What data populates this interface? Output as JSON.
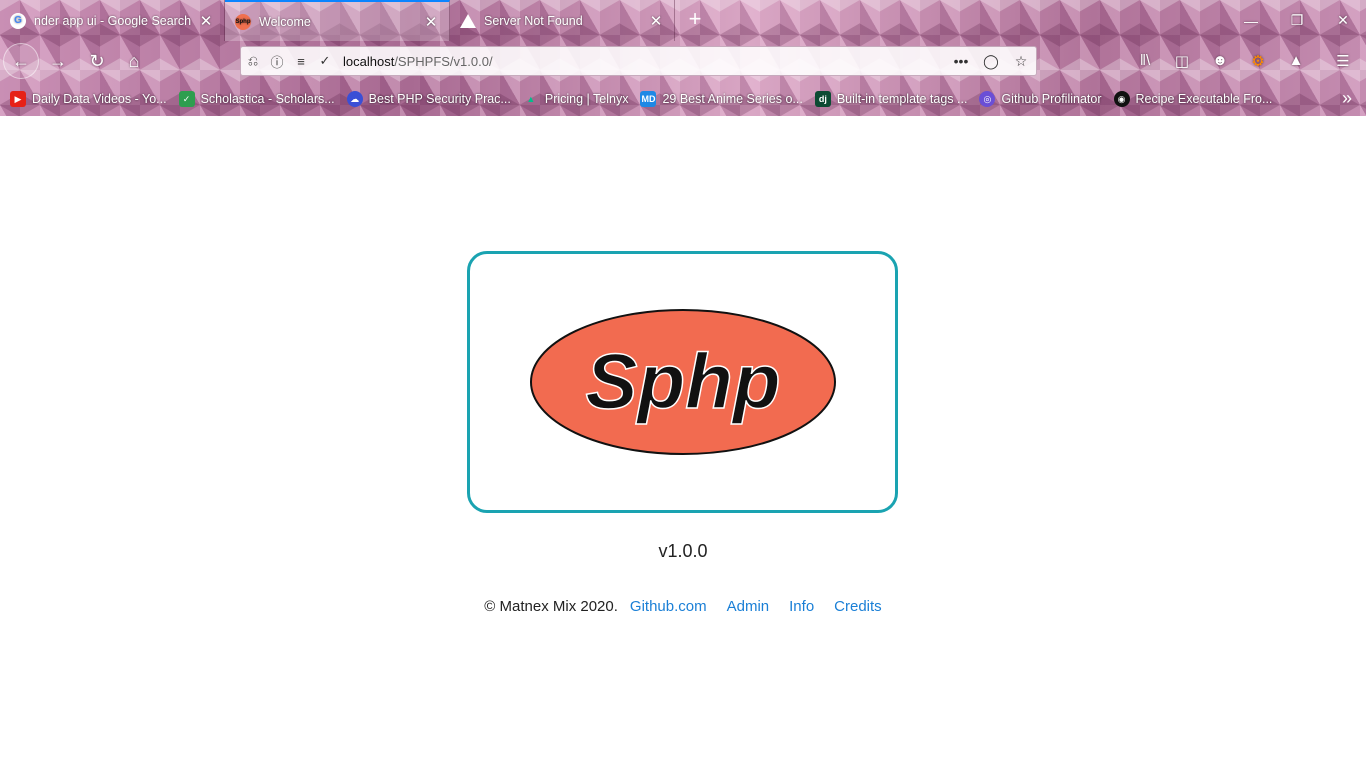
{
  "browser": {
    "tabs": [
      {
        "title": "nder app ui - Google Search",
        "favicon": "google-icon",
        "active": false
      },
      {
        "title": "Welcome",
        "favicon": "sphp-favicon",
        "active": true
      },
      {
        "title": "Server Not Found",
        "favicon": "warning-icon",
        "active": false
      }
    ],
    "url_host": "localhost",
    "url_path": "/SPHPFS/v1.0.0/",
    "bookmarks": [
      {
        "label": "Daily Data Videos - Yo...",
        "icon": "youtube-icon",
        "color": "#e62117"
      },
      {
        "label": "Scholastica - Scholars...",
        "icon": "shield-check-icon",
        "color": "#2e9e4f"
      },
      {
        "label": "Best PHP Security Prac...",
        "icon": "cloud-icon",
        "color": "#3a4fd6"
      },
      {
        "label": "Pricing | Telnyx",
        "icon": "telnyx-icon",
        "color": "#00c08b"
      },
      {
        "label": "29 Best Anime Series o...",
        "icon": "md-icon",
        "color": "#1e88e5"
      },
      {
        "label": "Built-in template tags ...",
        "icon": "django-icon",
        "color": "#0c4b33"
      },
      {
        "label": "Github Profilinator",
        "icon": "profilinator-icon",
        "color": "#6a4fd6"
      },
      {
        "label": "Recipe Executable Fro...",
        "icon": "github-icon",
        "color": "#111111"
      }
    ]
  },
  "page": {
    "logo_text": "Sphp",
    "logo_colors": {
      "oval": "#f26b50",
      "text": "#111111",
      "border": "#1aa3b1"
    },
    "version": "v1.0.0",
    "copyright": "© Matnex Mix 2020.",
    "links": [
      "Github.com",
      "Admin",
      "Info",
      "Credits"
    ]
  }
}
